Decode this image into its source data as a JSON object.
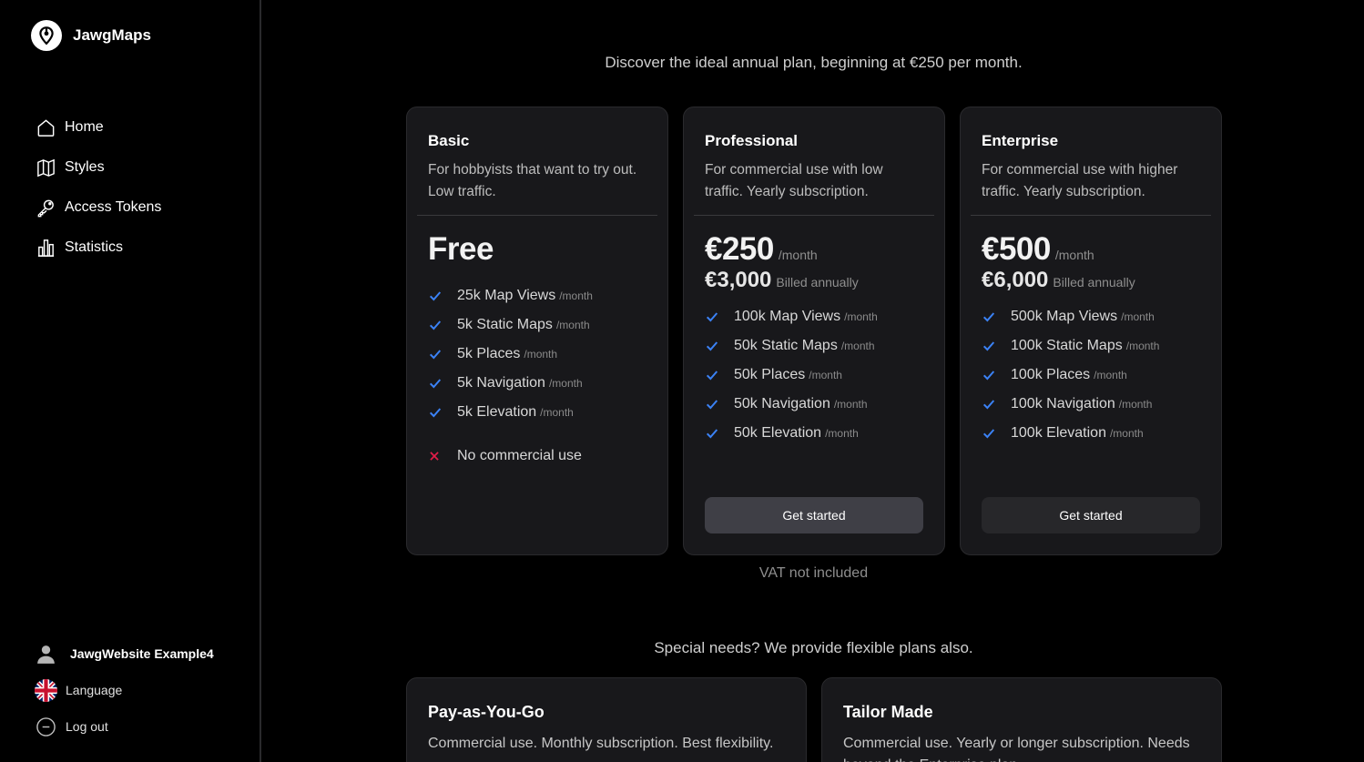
{
  "brand": {
    "name": "JawgMaps"
  },
  "nav": [
    {
      "label": "Home",
      "icon": "home-icon"
    },
    {
      "label": "Styles",
      "icon": "map-icon"
    },
    {
      "label": "Access Tokens",
      "icon": "key-icon"
    },
    {
      "label": "Statistics",
      "icon": "bar-chart-icon"
    }
  ],
  "account": {
    "user_name": "JawgWebsite Example4",
    "language_label": "Language",
    "logout_label": "Log out"
  },
  "intro": "Discover the ideal annual plan, beginning at €250 per month.",
  "plans": [
    {
      "title": "Basic",
      "desc": "For hobbyists that want to try out. Low traffic.",
      "price": "Free",
      "features": [
        {
          "text": "25k Map Views",
          "unit": "/month"
        },
        {
          "text": "5k Static Maps",
          "unit": "/month"
        },
        {
          "text": "5k Places",
          "unit": "/month"
        },
        {
          "text": "5k Navigation",
          "unit": "/month"
        },
        {
          "text": "5k Elevation",
          "unit": "/month"
        }
      ],
      "limitation": "No commercial use"
    },
    {
      "title": "Professional",
      "desc": "For commercial use with low traffic. Yearly subscription.",
      "price": "€250",
      "per": "/month",
      "annual": "€3,000",
      "billed": "Billed annually",
      "features": [
        {
          "text": "100k Map Views",
          "unit": "/month"
        },
        {
          "text": "50k Static Maps",
          "unit": "/month"
        },
        {
          "text": "50k Places",
          "unit": "/month"
        },
        {
          "text": "50k Navigation",
          "unit": "/month"
        },
        {
          "text": "50k Elevation",
          "unit": "/month"
        }
      ],
      "button": "Get started"
    },
    {
      "title": "Enterprise",
      "desc": "For commercial use with higher traffic. Yearly subscription.",
      "price": "€500",
      "per": "/month",
      "annual": "€6,000",
      "billed": "Billed annually",
      "features": [
        {
          "text": "500k Map Views",
          "unit": "/month"
        },
        {
          "text": "100k Static Maps",
          "unit": "/month"
        },
        {
          "text": "100k Places",
          "unit": "/month"
        },
        {
          "text": "100k Navigation",
          "unit": "/month"
        },
        {
          "text": "100k Elevation",
          "unit": "/month"
        }
      ],
      "button": "Get started"
    }
  ],
  "vat_note": "VAT not included",
  "special_title": "Special needs? We provide flexible plans also.",
  "flex_plans": [
    {
      "title": "Pay-as-You-Go",
      "desc": "Commercial use. Monthly subscription. Best flexibility."
    },
    {
      "title": "Tailor Made",
      "desc": "Commercial use. Yearly or longer subscription. Needs beyond the Enterprise plan."
    }
  ],
  "colors": {
    "check": "#3b82f6",
    "cross": "#e11d48",
    "card_bg": "#18181b",
    "button_primary": "#3f3f46",
    "button_secondary": "#27272a"
  }
}
